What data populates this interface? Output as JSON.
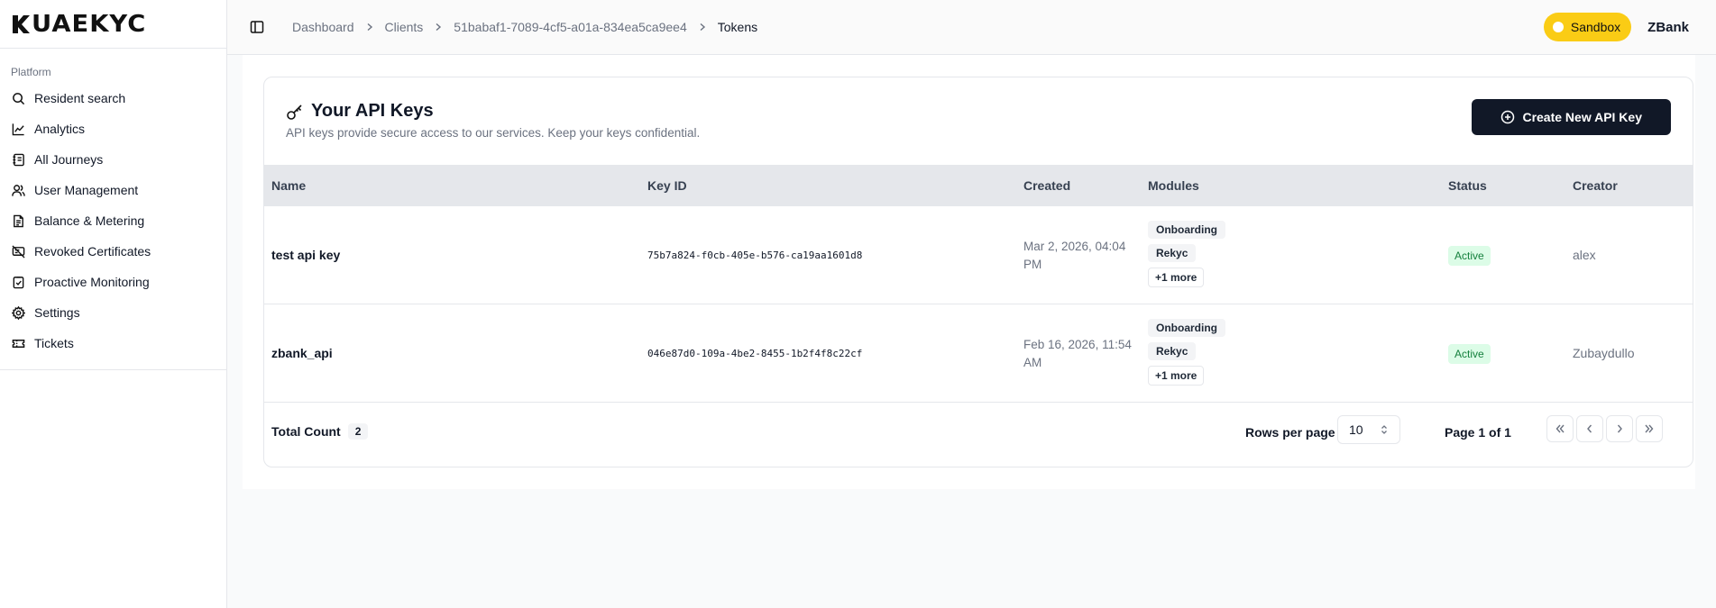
{
  "brand": {
    "logo_text": "UAEKYC"
  },
  "sidebar": {
    "group_label": "Platform",
    "items": [
      {
        "label": "Resident search",
        "icon": "search-icon"
      },
      {
        "label": "Analytics",
        "icon": "chart-line-icon"
      },
      {
        "label": "All Journeys",
        "icon": "notebook-icon"
      },
      {
        "label": "User Management",
        "icon": "users-icon"
      },
      {
        "label": "Balance & Metering",
        "icon": "file-text-icon"
      },
      {
        "label": "Revoked Certificates",
        "icon": "certificate-off-icon"
      },
      {
        "label": "Proactive Monitoring",
        "icon": "clipboard-check-icon"
      },
      {
        "label": "Settings",
        "icon": "gear-icon"
      },
      {
        "label": "Tickets",
        "icon": "ticket-icon"
      }
    ]
  },
  "header": {
    "breadcrumbs": [
      "Dashboard",
      "Clients",
      "51babaf1-7089-4cf5-a01a-834ea5ca9ee4",
      "Tokens"
    ],
    "environment": "Sandbox",
    "organization": "ZBank"
  },
  "card": {
    "title": "Your API Keys",
    "subtitle": "API keys provide secure access to our services. Keep your keys confidential.",
    "create_button": "Create New API Key"
  },
  "table": {
    "columns": [
      "Name",
      "Key ID",
      "Created",
      "Modules",
      "Status",
      "Creator"
    ],
    "rows": [
      {
        "name": "test api key",
        "key_id": "75b7a824-f0cb-405e-b576-ca19aa1601d8",
        "created": "Mar 2, 2026, 04:04 PM",
        "modules": [
          "Onboarding",
          "Rekyc"
        ],
        "more": "+1 more",
        "status": "Active",
        "creator": "alex"
      },
      {
        "name": "zbank_api",
        "key_id": "046e87d0-109a-4be2-8455-1b2f4f8c22cf",
        "created": "Feb 16, 2026, 11:54 AM",
        "modules": [
          "Onboarding",
          "Rekyc"
        ],
        "more": "+1 more",
        "status": "Active",
        "creator": "Zubaydullo"
      }
    ]
  },
  "pagination": {
    "total_label": "Total Count",
    "total_count": "2",
    "rows_per_page_label": "Rows per page",
    "rows_per_page": "10",
    "page_info": "Page 1 of 1"
  },
  "colors": {
    "primary": "#111827",
    "sandbox": "#facc15",
    "status_active_bg": "#dcfce7",
    "status_active_text": "#15803d"
  }
}
